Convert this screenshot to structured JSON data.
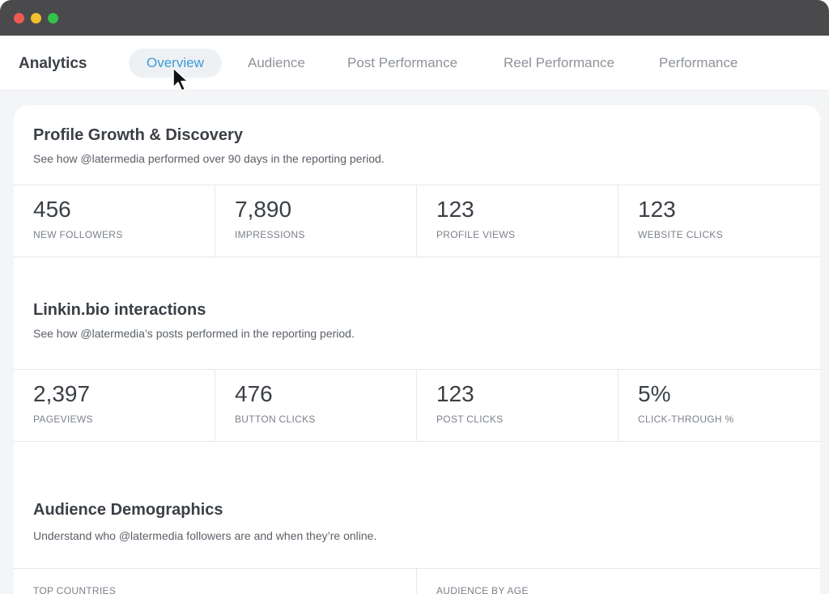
{
  "header": {
    "app_title": "Analytics",
    "tabs": [
      {
        "label": "Overview",
        "active": true
      },
      {
        "label": "Audience",
        "active": false
      },
      {
        "label": "Post Performance",
        "active": false
      },
      {
        "label": "Reel Performance",
        "active": false
      },
      {
        "label": "Performance",
        "active": false
      }
    ]
  },
  "profile_growth": {
    "title": "Profile Growth & Discovery",
    "subtitle": "See how @latermedia performed over 90 days in the reporting period.",
    "stats": [
      {
        "value": "456",
        "label": "NEW FOLLOWERS"
      },
      {
        "value": "7,890",
        "label": "IMPRESSIONS"
      },
      {
        "value": "123",
        "label": "PROFILE VIEWS"
      },
      {
        "value": "123",
        "label": "WEBSITE CLICKS"
      }
    ]
  },
  "linkin_bio": {
    "title": "Linkin.bio interactions",
    "subtitle": "See how @latermedia’s posts performed in the reporting period.",
    "stats": [
      {
        "value": "2,397",
        "label": "PAGEVIEWS"
      },
      {
        "value": "476",
        "label": "BUTTON CLICKS"
      },
      {
        "value": "123",
        "label": "POST CLICKS"
      },
      {
        "value": "5%",
        "label": "CLICK-THROUGH %"
      }
    ]
  },
  "audience_demographics": {
    "title": "Audience Demographics",
    "subtitle": "Understand who @latermedia followers are and when they’re online.",
    "columns": [
      {
        "label": "TOP COUNTRIES"
      },
      {
        "label": "AUDIENCE BY AGE"
      }
    ]
  },
  "colors": {
    "accent": "#3f9ad8",
    "titlebar": "#4a4a4c",
    "close": "#ed5b53",
    "minimize": "#f3be2f",
    "zoom": "#35c14a"
  }
}
